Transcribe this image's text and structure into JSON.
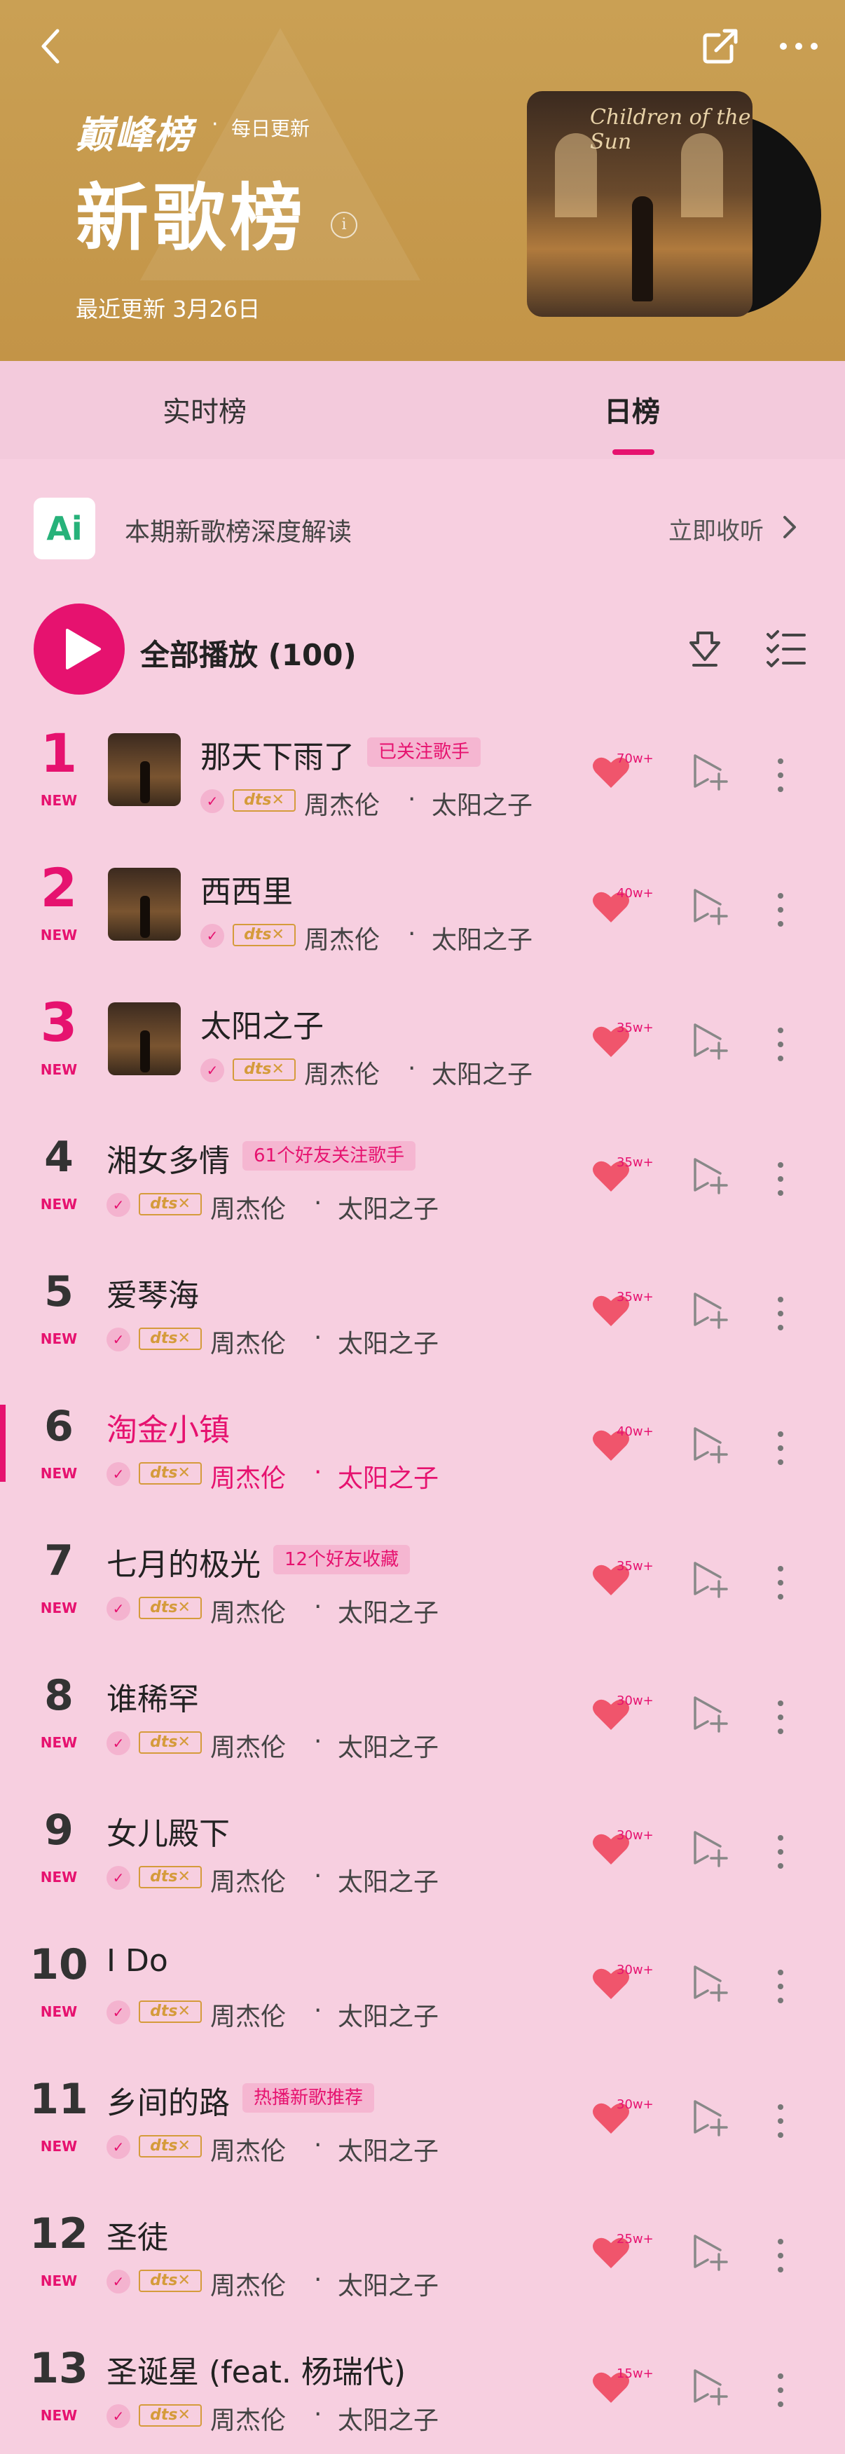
{
  "header": {
    "brand": "巅峰榜",
    "daily_update": "每日更新",
    "title": "新歌榜",
    "info": "i",
    "update_date": "最近更新 3月26日",
    "album_script": "Children of the Sun"
  },
  "tabs": [
    {
      "label": "实时榜",
      "active": false
    },
    {
      "label": "日榜",
      "active": true
    }
  ],
  "ai": {
    "logo": "Ai",
    "text": "本期新歌榜深度解读",
    "listen": "立即收听"
  },
  "play_all": {
    "label": "全部播放 (100)"
  },
  "colors": {
    "accent": "#e6126f",
    "header_bg": "#c89b4d",
    "page_bg": "#f7cfe0"
  },
  "songs": [
    {
      "rank": "1",
      "new": "NEW",
      "title": "那天下雨了",
      "tag": "已关注歌手",
      "artist": "周杰伦",
      "sep": "·",
      "album": "太阳之子",
      "likes": "70w+",
      "dts": "dts✕",
      "vip": "✓",
      "thumb": true
    },
    {
      "rank": "2",
      "new": "NEW",
      "title": "西西里",
      "tag": "",
      "artist": "周杰伦",
      "sep": "·",
      "album": "太阳之子",
      "likes": "40w+",
      "dts": "dts✕",
      "vip": "✓",
      "thumb": true
    },
    {
      "rank": "3",
      "new": "NEW",
      "title": "太阳之子",
      "tag": "",
      "artist": "周杰伦",
      "sep": "·",
      "album": "太阳之子",
      "likes": "35w+",
      "dts": "dts✕",
      "vip": "✓",
      "thumb": true
    },
    {
      "rank": "4",
      "new": "NEW",
      "title": "湘女多情",
      "tag": "61个好友关注歌手",
      "artist": "周杰伦",
      "sep": "·",
      "album": "太阳之子",
      "likes": "35w+",
      "dts": "dts✕",
      "vip": "✓",
      "thumb": false
    },
    {
      "rank": "5",
      "new": "NEW",
      "title": "爱琴海",
      "tag": "",
      "artist": "周杰伦",
      "sep": "·",
      "album": "太阳之子",
      "likes": "35w+",
      "dts": "dts✕",
      "vip": "✓",
      "thumb": false
    },
    {
      "rank": "6",
      "new": "NEW",
      "title": "淘金小镇",
      "tag": "",
      "artist": "周杰伦",
      "sep": "·",
      "album": "太阳之子",
      "likes": "40w+",
      "dts": "dts✕",
      "vip": "✓",
      "thumb": false,
      "active": true
    },
    {
      "rank": "7",
      "new": "NEW",
      "title": "七月的极光",
      "tag": "12个好友收藏",
      "artist": "周杰伦",
      "sep": "·",
      "album": "太阳之子",
      "likes": "35w+",
      "dts": "dts✕",
      "vip": "✓",
      "thumb": false
    },
    {
      "rank": "8",
      "new": "NEW",
      "title": "谁稀罕",
      "tag": "",
      "artist": "周杰伦",
      "sep": "·",
      "album": "太阳之子",
      "likes": "30w+",
      "dts": "dts✕",
      "vip": "✓",
      "thumb": false
    },
    {
      "rank": "9",
      "new": "NEW",
      "title": "女儿殿下",
      "tag": "",
      "artist": "周杰伦",
      "sep": "·",
      "album": "太阳之子",
      "likes": "30w+",
      "dts": "dts✕",
      "vip": "✓",
      "thumb": false
    },
    {
      "rank": "10",
      "new": "NEW",
      "title": "I Do",
      "tag": "",
      "artist": "周杰伦",
      "sep": "·",
      "album": "太阳之子",
      "likes": "30w+",
      "dts": "dts✕",
      "vip": "✓",
      "thumb": false
    },
    {
      "rank": "11",
      "new": "NEW",
      "title": "乡间的路",
      "tag": "热播新歌推荐",
      "artist": "周杰伦",
      "sep": "·",
      "album": "太阳之子",
      "likes": "30w+",
      "dts": "dts✕",
      "vip": "✓",
      "thumb": false
    },
    {
      "rank": "12",
      "new": "NEW",
      "title": "圣徒",
      "tag": "",
      "artist": "周杰伦",
      "sep": "·",
      "album": "太阳之子",
      "likes": "25w+",
      "dts": "dts✕",
      "vip": "✓",
      "thumb": false
    },
    {
      "rank": "13",
      "new": "NEW",
      "title": "圣诞星 (feat. 杨瑞代)",
      "tag": "",
      "artist": "周杰伦",
      "sep": "·",
      "album": "太阳之子",
      "likes": "15w+",
      "dts": "dts✕",
      "vip": "✓",
      "thumb": false
    }
  ]
}
